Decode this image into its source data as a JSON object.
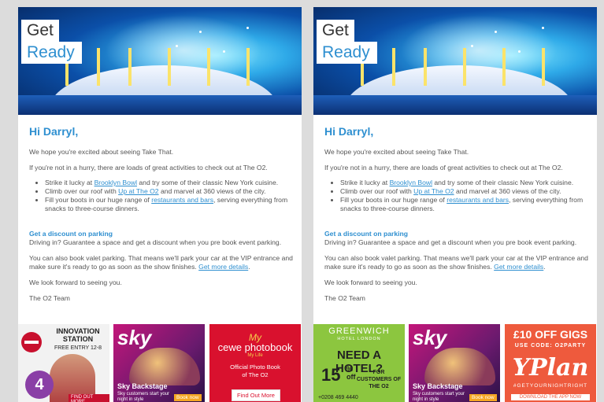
{
  "hero": {
    "get": "Get",
    "ready": "Ready"
  },
  "greeting": "Hi Darryl,",
  "intro": "We hope you're excited about seeing Take That.",
  "activities_intro": "If you're not in a hurry, there are loads of great activities to check out at The O2.",
  "bullets": [
    {
      "pre": "Strike it lucky at ",
      "link": "Brooklyn Bowl",
      "post": " and try some of their classic New York cuisine."
    },
    {
      "pre": "Climb over our roof with ",
      "link": "Up at The O2",
      "post": " and marvel at 360 views of the city."
    },
    {
      "pre": "Fill your boots in our huge range of ",
      "link": "restaurants and bars",
      "post": ", serving everything from snacks to three-course dinners."
    }
  ],
  "parking": {
    "heading": "Get a discount on parking",
    "text": "Driving in? Guarantee a space and get a discount when you pre book event parking.",
    "valet": "You can also book valet parking. That means we'll park your car at the VIP entrance and make sure it's ready to go as soon as the show finishes. ",
    "valet_link": "Get more details",
    "valet_end": "."
  },
  "closing": "We look forward to seeing you.",
  "signoff": "The O2 Team",
  "banners_left": {
    "innovation": {
      "title": "INNOVATION STATION",
      "sub": "FREE ENTRY 12-8",
      "btn": "FIND OUT MORE"
    },
    "sky": {
      "logo": "sky",
      "title": "Sky Backstage",
      "text": "Sky customers start your night in style",
      "btn": "Book now"
    },
    "cewe": {
      "my": "My",
      "name": "cewe photobook",
      "mylife": "My Life",
      "text1": "Official Photo Book",
      "text2": "of The O2",
      "btn": "Find Out More"
    }
  },
  "banners_right": {
    "greenwich": {
      "name": "GREENWICH",
      "sub": "HOTEL LONDON",
      "title": "NEED A HOTEL?",
      "pct": "15",
      "pct_sign": "%",
      "off": "off",
      "for": "FOR CUSTOMERS OF THE O2",
      "phone": "+0208 469 4440"
    },
    "sky": {
      "logo": "sky",
      "title": "Sky Backstage",
      "text": "Sky customers start your night in style",
      "btn": "Book now"
    },
    "yplan": {
      "offer": "£10 OFF GIGS",
      "code": "USE CODE: O2PARTY",
      "logo": "YPlan",
      "tag": "#GETYOURNIGHTRIGHT",
      "btn": "DOWNLOAD THE APP NOW"
    }
  },
  "badge": "4"
}
